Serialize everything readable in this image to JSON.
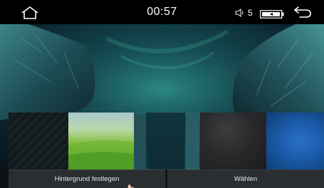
{
  "status_bar": {
    "time": "00:57",
    "volume_level": "5",
    "icons": [
      "home-icon",
      "volume-icon",
      "battery-icon",
      "back-icon"
    ]
  },
  "wallpaper_preview": {
    "description_icon": "aurora-wallpaper"
  },
  "thumbnails": [
    {
      "name": "dark-texture"
    },
    {
      "name": "green-field"
    },
    {
      "name": "aurora",
      "selected": true
    },
    {
      "name": "dark-clouds"
    },
    {
      "name": "blue-glow"
    }
  ],
  "buttons": {
    "set_wallpaper": "Hintergrund festlegen",
    "choose": "Wählen"
  },
  "colors": {
    "status_bar_bg": "#000000",
    "button_bg": "#2b2e30",
    "wallpaper_teal": "#1e6d72"
  }
}
